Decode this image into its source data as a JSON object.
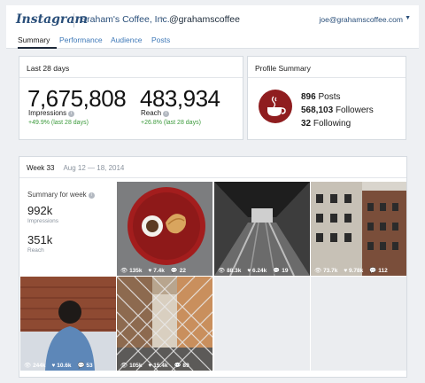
{
  "header": {
    "brand": "Instagram",
    "account": "Graham's Coffee, Inc.",
    "chevron": "›",
    "handle": "@grahamscoffee",
    "email": "joe@grahamscoffee.com",
    "caret": "▼"
  },
  "tabs": [
    {
      "label": "Summary",
      "active": true
    },
    {
      "label": "Performance",
      "active": false
    },
    {
      "label": "Audience",
      "active": false
    },
    {
      "label": "Posts",
      "active": false
    }
  ],
  "last28": {
    "title": "Last 28 days",
    "impressions": {
      "value": "7,675,808",
      "label": "Impressions",
      "delta": "+49.9% (last 28 days)"
    },
    "reach": {
      "value": "483,934",
      "label": "Reach",
      "delta": "+26.8% (last 28 days)"
    },
    "info_icon": "i"
  },
  "profile": {
    "title": "Profile Summary",
    "posts_value": "896",
    "posts_label": "Posts",
    "followers_value": "568,103",
    "followers_label": "Followers",
    "following_value": "32",
    "following_label": "Following",
    "logo_icon": "coffee-cup-icon"
  },
  "week": {
    "title": "Week 33",
    "range": "Aug 12 — 18, 2014",
    "summary_label": "Summary for week",
    "impressions_value": "992k",
    "impressions_label": "Impressions",
    "reach_value": "351k",
    "reach_label": "Reach",
    "posts": [
      {
        "views": "135k",
        "likes": "7.4k",
        "comments": "22"
      },
      {
        "views": "88.3k",
        "likes": "6.24k",
        "comments": "19"
      },
      {
        "views": "73.7k",
        "likes": "9.78k",
        "comments": "112"
      },
      {
        "views": "244k",
        "likes": "10.6k",
        "comments": "53"
      },
      {
        "views": "105k",
        "likes": "15.4k",
        "comments": "89"
      }
    ]
  },
  "colors": {
    "accent": "#3f79b8",
    "positive": "#3b9a3b",
    "brand_red": "#8f1d1f"
  }
}
